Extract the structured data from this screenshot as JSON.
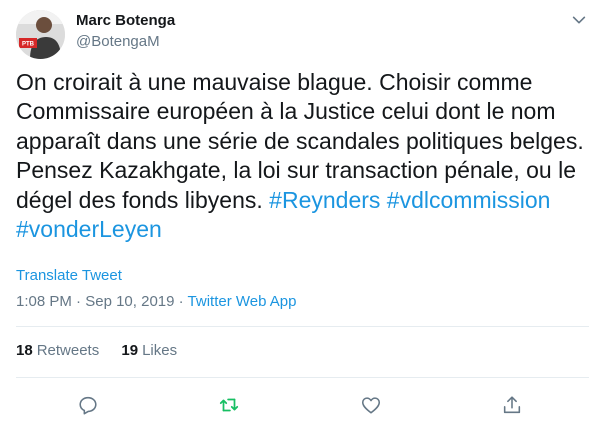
{
  "author": {
    "display_name": "Marc Botenga",
    "handle": "@BotengaM",
    "avatar_text": "PTB"
  },
  "tweet": {
    "text_parts": [
      "On croirait à une mauvaise blague. Choisir comme\nCommissaire européen à la Justice celui dont le nom\napparaît dans une série de scandales politiques belges.\nPensez Kazakhgate, la loi sur transaction pénale, ou le\ndégel des fonds libyens. ",
      " ",
      "\n"
    ],
    "hashtags": [
      "#Reynders",
      "#vdlcommission",
      "#vonderLeyen"
    ]
  },
  "translate_label": "Translate Tweet",
  "meta": {
    "time": "1:08 PM",
    "separator": " · ",
    "date": "Sep 10, 2019",
    "source": "Twitter Web App"
  },
  "stats": [
    {
      "count": "18",
      "label": "Retweets"
    },
    {
      "count": "19",
      "label": "Likes"
    }
  ],
  "icons": {
    "caret": "chevron-down-icon",
    "reply": "reply-icon",
    "retweet": "retweet-icon",
    "like": "heart-icon",
    "share": "share-icon"
  },
  "colors": {
    "link": "#1b95e0",
    "muted": "#657786",
    "text": "#14171a",
    "retweet_active": "#17bf63"
  }
}
